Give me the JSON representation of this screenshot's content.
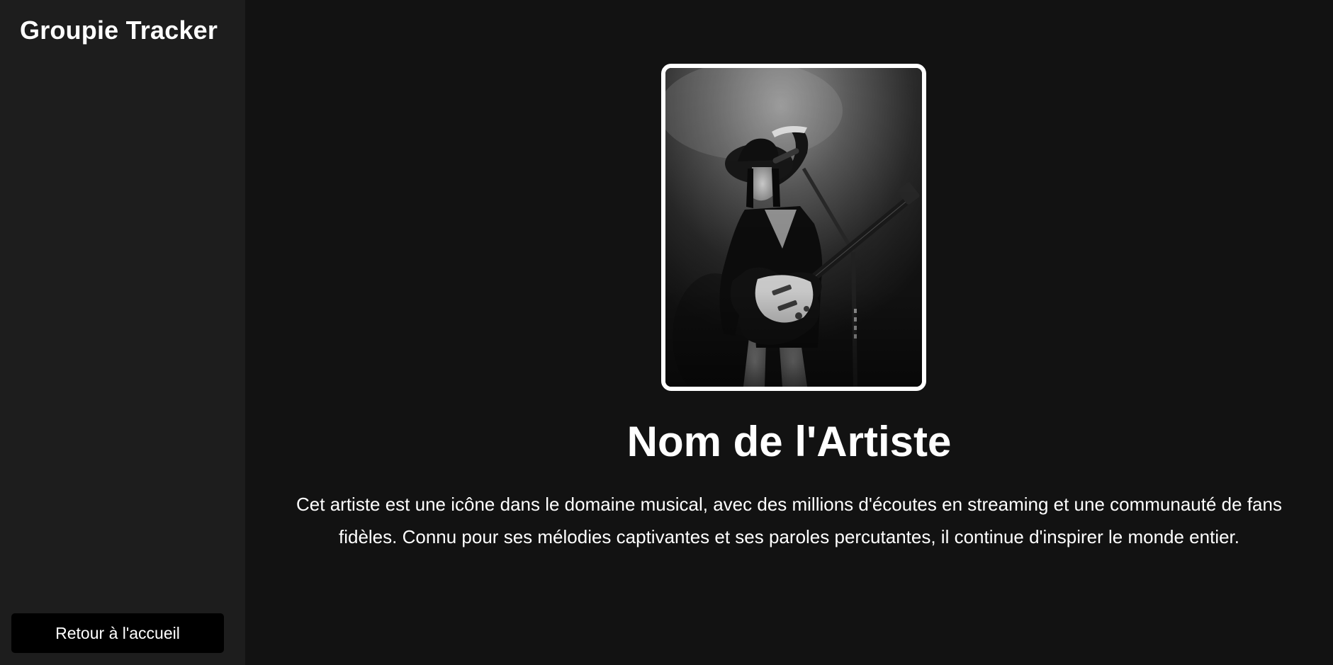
{
  "sidebar": {
    "app_title": "Groupie Tracker",
    "home_button_label": "Retour à l'accueil"
  },
  "artist": {
    "photo_alt": "Nom de l'Artiste",
    "name": "Nom de l'Artiste",
    "bio": "Cet artiste est une icône dans le domaine musical, avec des millions d'écoutes en streaming et une communauté de fans fidèles. Connu pour ses mélodies captivantes et ses paroles percutantes, il continue d'inspirer le monde entier."
  },
  "colors": {
    "page_background": "#121212",
    "sidebar_background": "#1d1d1d",
    "button_background": "#000000",
    "text": "#ffffff",
    "photo_border": "#ffffff"
  }
}
